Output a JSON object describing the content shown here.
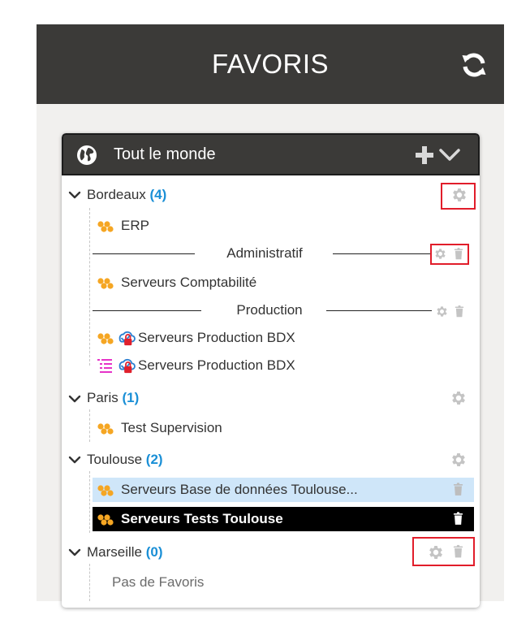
{
  "header": {
    "title": "FAVORIS",
    "refresh_icon": "refresh-icon"
  },
  "card": {
    "title": "Tout le monde",
    "globe_icon": "globe-icon",
    "add_icon": "plus-icon",
    "collapse_icon": "chevron-down-icon"
  },
  "groups": [
    {
      "name": "Bordeaux",
      "count": "(4)",
      "items": [
        {
          "label": "ERP"
        },
        {
          "separator": "Administratif"
        },
        {
          "label": "Serveurs Comptabilité"
        },
        {
          "separator": "Production"
        },
        {
          "label": "Serveurs Production BDX"
        },
        {
          "label": "Serveurs Production BDX"
        }
      ]
    },
    {
      "name": "Paris",
      "count": "(1)",
      "items": [
        {
          "label": "Test Supervision"
        }
      ]
    },
    {
      "name": "Toulouse",
      "count": "(2)",
      "items": [
        {
          "label": "Serveurs Base de données Toulouse..."
        },
        {
          "label": "Serveurs Tests Toulouse"
        }
      ]
    },
    {
      "name": "Marseille",
      "count": "(0)",
      "empty_text": "Pas de Favoris"
    }
  ],
  "colors": {
    "header_bg": "#3b3a38",
    "count_blue": "#1a8fd6",
    "highlight_red": "#e11d2a",
    "selected_light": "#cfe6f9",
    "selected_dark": "#000000",
    "hex_orange": "#f5a623"
  }
}
